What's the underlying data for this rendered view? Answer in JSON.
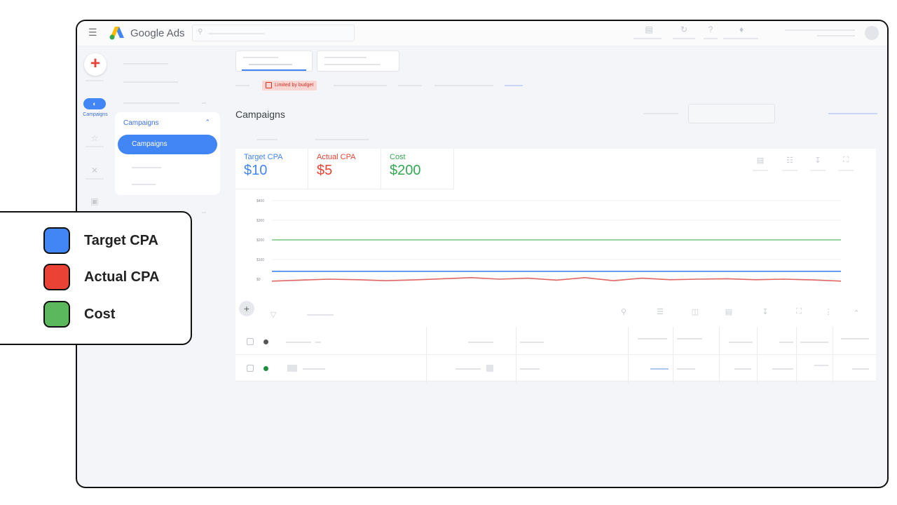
{
  "app": {
    "brand": "Google Ads",
    "menu_icon": "menu-icon",
    "search_icon": "search-icon"
  },
  "rail": {
    "active_label": "Campaigns",
    "create_icon": "+",
    "campaign_icon": "◐"
  },
  "nav": {
    "section_label": "Campaigns",
    "active_item": "Campaigns"
  },
  "status": {
    "budget_badge": "Limited by budget"
  },
  "page": {
    "title": "Campaigns"
  },
  "metrics": [
    {
      "label": "Target CPA",
      "value": "$10",
      "color": "#4285f4"
    },
    {
      "label": "Actual CPA",
      "value": "$5",
      "color": "#ea4335"
    },
    {
      "label": "Cost",
      "value": "$200",
      "color": "#34a853"
    }
  ],
  "chart_data": {
    "type": "line",
    "y_ticks": [
      "$400",
      "$300",
      "$200",
      "$100",
      "$0"
    ],
    "ylim": [
      0,
      400
    ],
    "grid": true,
    "series": [
      {
        "name": "Cost",
        "color": "#7cc47f",
        "values": [
          200,
          200,
          200,
          200,
          200,
          200,
          200,
          200,
          200,
          200,
          200,
          200,
          200,
          200,
          200,
          200,
          200,
          200,
          200,
          200,
          200
        ]
      },
      {
        "name": "Target CPA",
        "color": "#4285f4",
        "values": [
          40,
          40,
          40,
          40,
          40,
          40,
          40,
          40,
          40,
          40,
          40,
          40,
          40,
          40,
          40,
          40,
          40,
          40,
          40,
          40,
          40
        ]
      },
      {
        "name": "Actual CPA",
        "color": "#e06666",
        "values": [
          -10,
          -5,
          0,
          -3,
          -8,
          -4,
          2,
          8,
          0,
          5,
          -5,
          8,
          -8,
          5,
          -3,
          0,
          2,
          -3,
          0,
          -4,
          -10
        ]
      }
    ]
  },
  "legend": [
    {
      "label": "Target CPA",
      "color": "#4285f4"
    },
    {
      "label": "Actual CPA",
      "color": "#ea4335"
    },
    {
      "label": "Cost",
      "color": "#5cb85c"
    }
  ],
  "table": {
    "add_icon": "+",
    "rows": [
      {
        "status_color": "#555555"
      },
      {
        "status_color": "#1e8e3e"
      }
    ]
  }
}
